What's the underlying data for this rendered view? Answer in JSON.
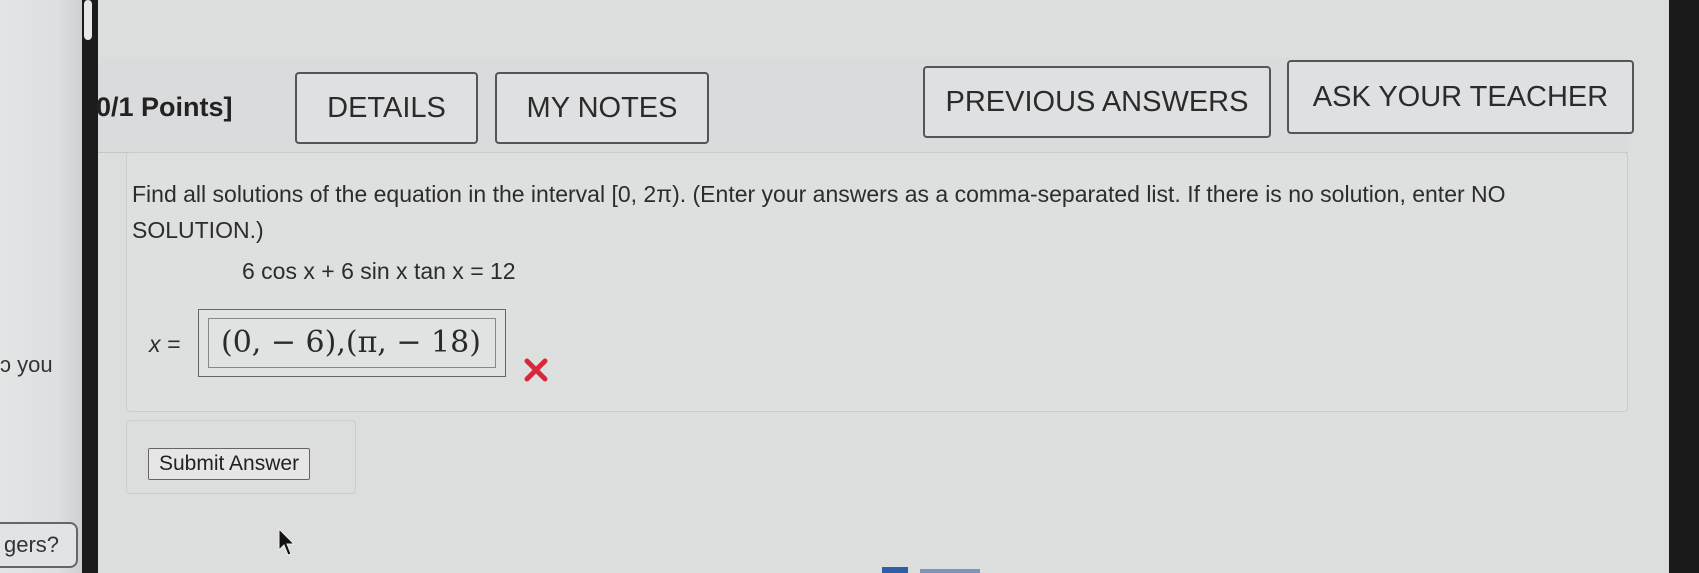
{
  "side": {
    "you_fragment": "ɔ you",
    "gers_fragment": "gers?"
  },
  "header": {
    "points": "0/1 Points]",
    "buttons": {
      "details": "DETAILS",
      "my_notes": "MY NOTES",
      "previous_answers": "PREVIOUS ANSWERS",
      "ask_teacher": "ASK YOUR TEACHER"
    }
  },
  "question": {
    "prompt": "Find all solutions of the equation in the interval [0, 2π). (Enter your answers as a comma-separated list. If there is no solution, enter NO SOLUTION.)",
    "equation": "6 cos x + 6 sin x tan x = 12",
    "answer_label": "x =",
    "answer_value": "(0, − 6),(π, − 18)",
    "result": "incorrect"
  },
  "submit": {
    "label": "Submit Answer"
  },
  "icons": {
    "wrong": "x-mark-icon",
    "cursor": "mouse-pointer-icon"
  },
  "colors": {
    "wrong": "#d9283a"
  }
}
